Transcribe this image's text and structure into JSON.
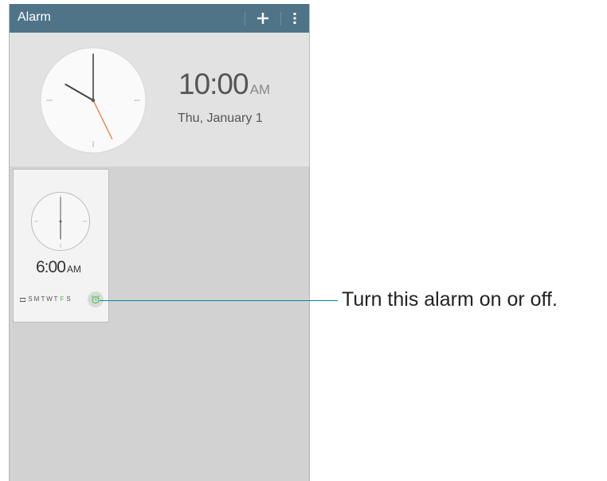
{
  "action_bar": {
    "title": "Alarm",
    "add_label": "+",
    "menu_label": "more-options"
  },
  "current": {
    "time": "10:00",
    "ampm": "AM",
    "date": "Thu, January 1",
    "clock_hour": 10,
    "clock_minute": 0,
    "clock_second": 25
  },
  "alarms": [
    {
      "time": "6:00",
      "ampm": "AM",
      "repeat_days": [
        "S",
        "M",
        "T",
        "W",
        "T",
        "F",
        "S"
      ],
      "active_day_indices": [
        5
      ],
      "enabled": true
    }
  ],
  "callout": {
    "text": "Turn this alarm on or off."
  },
  "colors": {
    "action_bar": "#4f7488",
    "screen_bg": "#d2d2d2",
    "clock_section_bg": "#e2e2e2",
    "second_hand": "#f07030",
    "active_day": "#4caf50",
    "callout_line": "#008a9a"
  },
  "icons": {
    "add": "plus-icon",
    "menu": "vertical-dots-icon",
    "repeat": "repeat-icon",
    "toggle": "alarm-clock-icon"
  }
}
